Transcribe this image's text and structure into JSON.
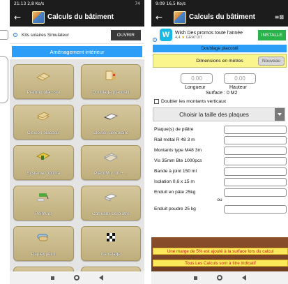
{
  "left": {
    "status": {
      "time": "21:13",
      "info": "2,8 Ko/s",
      "right": "74"
    },
    "appbar": {
      "title": "Calculs du bâtiment"
    },
    "ad": {
      "text": "Kits solaires Simulateur",
      "button": "OUVRIR"
    },
    "section": "Aménagement intérieur",
    "tiles": [
      {
        "label": "Plafond placostil",
        "icon": "ceiling-icon"
      },
      {
        "label": "Doublage placostil",
        "icon": "wall-lining-icon"
      },
      {
        "label": "Cloison placostil",
        "icon": "partition-icon"
      },
      {
        "label": "Cloison alvéolaire",
        "icon": "honeycomb-partition-icon"
      },
      {
        "label": "Systeme Optima",
        "icon": "optima-system-icon"
      },
      {
        "label": "PlacoMur 10 + ..",
        "icon": "placomur-icon"
      },
      {
        "label": "Peinture",
        "icon": "paint-roller-icon"
      },
      {
        "label": "Carreaux de plâtre",
        "icon": "plaster-tile-icon"
      },
      {
        "label": "Papier peint",
        "icon": "wallpaper-icon"
      },
      {
        "label": "Carrelage",
        "icon": "tiling-icon"
      }
    ]
  },
  "right": {
    "status": {
      "time": "9:09",
      "info": "16,5 Ko/s"
    },
    "appbar": {
      "title": "Calculs du bâtiment",
      "tool": "≡⊠"
    },
    "ad": {
      "logo": "W",
      "title": "Wish Des promos toute l'année",
      "rating": "4,4",
      "free": "GRATUIT",
      "button": "INSTALLE"
    },
    "header": "Doublage placostil",
    "dimensions": {
      "label": "Dimensions en mètres",
      "button": "Nouveau"
    },
    "longueur": {
      "value": "0.00",
      "label": "Longueur"
    },
    "hauteur": {
      "value": "0.00",
      "label": "Hauteur"
    },
    "surface": "Surface : 0 M2",
    "checkbox": "Doubler les montants verticaux",
    "select": "Choisir la taille des plaques",
    "items": [
      "Plaque(s) de plâtre",
      "Rail métal R 48 3 m",
      "Montants type M48 3m",
      "Vis 35mm Bte 1000pcs",
      "Bande à joint 150 ml",
      "Isolation 0,6 x 15 m",
      "Enduit en pâte 25kg"
    ],
    "or": "ou",
    "last_item": "Enduit poudre 25 kg",
    "warnings": [
      "Une marge de 5% est ajouté à la surface lors du calcul",
      "Tous Les Calculs sont à titre indicatif"
    ]
  }
}
